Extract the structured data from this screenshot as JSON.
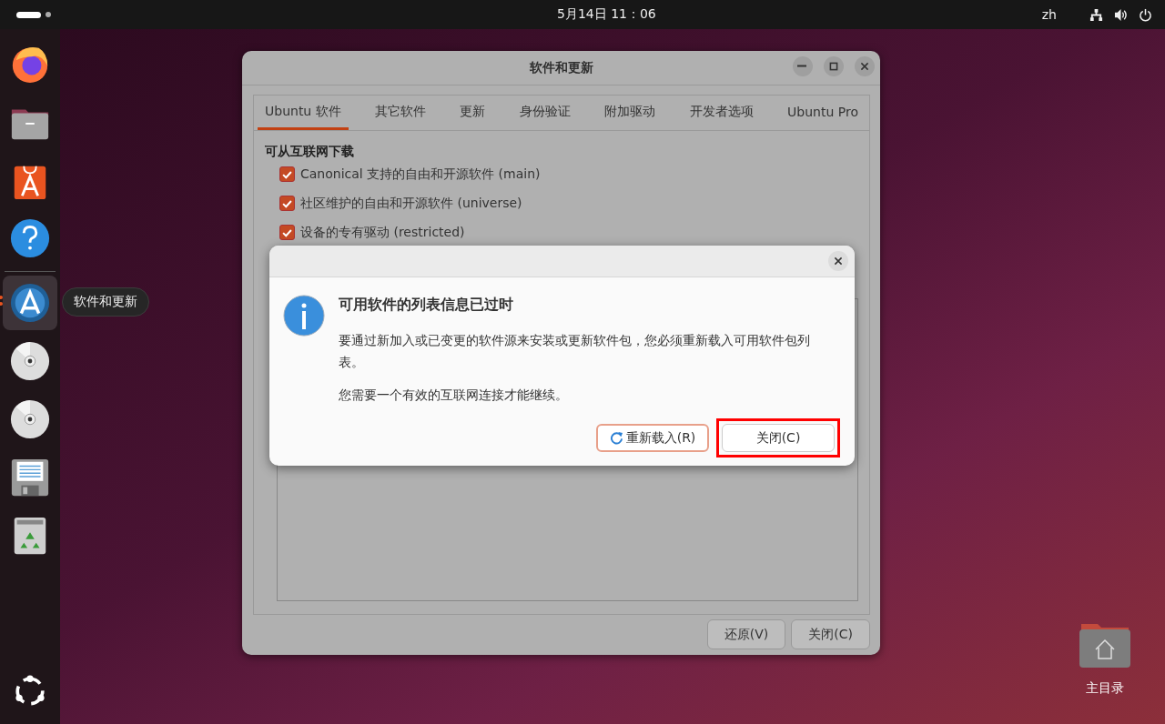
{
  "top_bar": {
    "clock": "5月14日  11：06",
    "language": "zh"
  },
  "dock": {
    "items": [
      {
        "kind": "firefox",
        "selected": false,
        "running": false
      },
      {
        "kind": "files",
        "selected": false,
        "running": false
      },
      {
        "kind": "appcenter",
        "selected": false,
        "running": false
      },
      {
        "kind": "help",
        "selected": false,
        "running": false
      },
      {
        "kind": "updater",
        "selected": true,
        "running": true,
        "tooltip": "软件和更新"
      },
      {
        "kind": "disc",
        "selected": false,
        "running": false
      },
      {
        "kind": "disc",
        "selected": false,
        "running": false
      },
      {
        "kind": "floppy",
        "selected": false,
        "running": false
      },
      {
        "kind": "trash",
        "selected": false,
        "running": false
      }
    ]
  },
  "window": {
    "title": "软件和更新",
    "tabs": [
      {
        "label": "Ubuntu 软件",
        "selected": true
      },
      {
        "label": "其它软件",
        "selected": false
      },
      {
        "label": "更新",
        "selected": false
      },
      {
        "label": "身份验证",
        "selected": false
      },
      {
        "label": "附加驱动",
        "selected": false
      },
      {
        "label": "开发者选项",
        "selected": false
      },
      {
        "label": "Ubuntu Pro",
        "selected": false
      }
    ],
    "section_title": "可从互联网下载",
    "sources": [
      {
        "label": "Canonical 支持的自由和开源软件 (main)",
        "checked": true
      },
      {
        "label": "社区维护的自由和开源软件 (universe)",
        "checked": true
      },
      {
        "label": "设备的专有驱动 (restricted)",
        "checked": true
      }
    ],
    "buttons": [
      "还原(V)",
      "关闭(C)"
    ]
  },
  "dialog": {
    "title": "可用软件的列表信息已过时",
    "paragraphs": [
      "要通过新加入或已变更的软件源来安装或更新软件包，您必须重新载入可用软件包列表。",
      "您需要一个有效的互联网连接才能继续。"
    ],
    "buttons": [
      {
        "label": "重新载入(R)",
        "kind": "reload",
        "highlighted": false
      },
      {
        "label": "关闭(C)",
        "kind": "plain",
        "highlighted": true
      }
    ]
  },
  "desktop": {
    "icons": [
      {
        "label": "主目录"
      }
    ]
  }
}
